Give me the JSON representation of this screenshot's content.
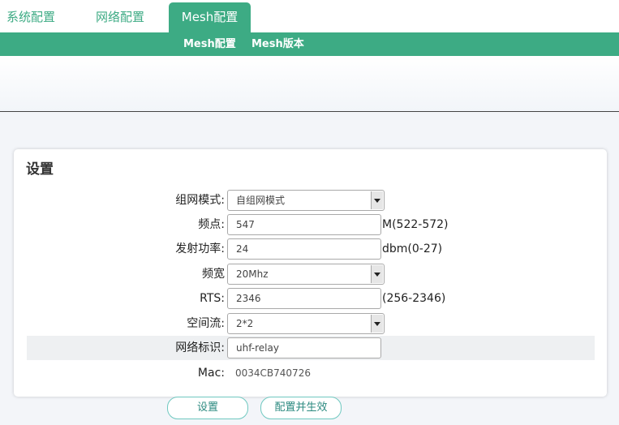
{
  "nav": {
    "tabs": [
      {
        "label": "系统配置"
      },
      {
        "label": "网络配置"
      },
      {
        "label": "Mesh配置",
        "active": true
      }
    ],
    "subtabs": [
      {
        "label": "Mesh配置"
      },
      {
        "label": "Mesh版本"
      }
    ]
  },
  "panel": {
    "title": "设置",
    "fields": {
      "mode": {
        "label": "组网模式:",
        "value": "自组网模式"
      },
      "freq": {
        "label": "频点:",
        "value": "547",
        "unit": "M(522-572)"
      },
      "power": {
        "label": "发射功率:",
        "value": "24",
        "unit": "dbm(0-27)"
      },
      "bandwidth": {
        "label": "频宽",
        "value": "20Mhz"
      },
      "rts": {
        "label": "RTS:",
        "value": "2346",
        "unit": "(256-2346)"
      },
      "stream": {
        "label": "空间流:",
        "value": "2*2"
      },
      "netid": {
        "label": "网络标识:",
        "value": "uhf-relay"
      },
      "mac": {
        "label": "Mac:",
        "value": "0034CB740726"
      }
    }
  },
  "buttons": {
    "save": "设置",
    "apply": "配置并生效"
  },
  "colors": {
    "accent": "#3dab84",
    "button_border": "#6fc8c0"
  }
}
